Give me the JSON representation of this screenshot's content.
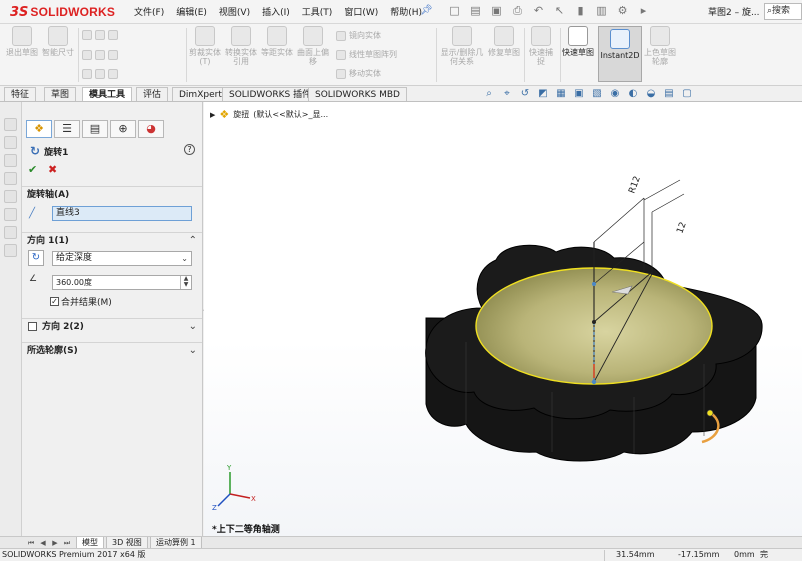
{
  "app": {
    "brand_prefix": "3S",
    "brand_name": "SOLIDWORKS"
  },
  "menus": [
    "文件(F)",
    "编辑(E)",
    "视图(V)",
    "插入(I)",
    "工具(T)",
    "窗口(W)",
    "帮助(H)"
  ],
  "document_title": "草图2 – 旋...",
  "search": {
    "placeholder": "搜索"
  },
  "commands": {
    "exit_sketch": "退出草图",
    "smart_dim": "智能尺寸",
    "trim": "剪裁实体(T)",
    "convert": "转换实体引用",
    "offset": "等距实体",
    "surface_offset": "曲面上偏移",
    "mirror": "镜向实体",
    "linear_pattern": "线性草图阵列",
    "move": "移动实体",
    "display_delete": "显示/删除几何关系",
    "repair": "修复草图",
    "quick_snap": "快速捕捉",
    "rapid_sketch": "快速草图",
    "instant2d": "Instant2D",
    "shaded_contours": "上色草图轮廓"
  },
  "tabs": [
    "特征",
    "草图",
    "模具工具",
    "评估",
    "DimXpert",
    "SOLIDWORKS 插件",
    "SOLIDWORKS MBD"
  ],
  "active_tab": "模具工具",
  "property_manager": {
    "feature_name": "旋转1",
    "axis_section": "旋转轴(A)",
    "axis_value": "直线3",
    "direction1_section": "方向 1(1)",
    "end_condition": "给定深度",
    "angle": "360.00度",
    "merge_label": "合并结果(M)",
    "merge_checked": true,
    "direction2_section": "方向 2(2)",
    "contours_section": "所选轮廓(S)"
  },
  "tree_flyout": {
    "feature": "旋扭",
    "config": "(默认<<默认>_显..."
  },
  "model": {
    "dim_radius": "R12",
    "dim_linear": "12",
    "body_color": "#111111",
    "face_color": "#c8c070",
    "edge_color": "#f0e020"
  },
  "view_label": "*上下二等角轴测",
  "bottom_tabs": [
    "模型",
    "3D 视图",
    "运动算例 1"
  ],
  "status": {
    "product": "SOLIDWORKS Premium 2017 x64 版",
    "x": "31.54mm",
    "y": "-17.15mm",
    "z": "0mm",
    "state": "完"
  }
}
